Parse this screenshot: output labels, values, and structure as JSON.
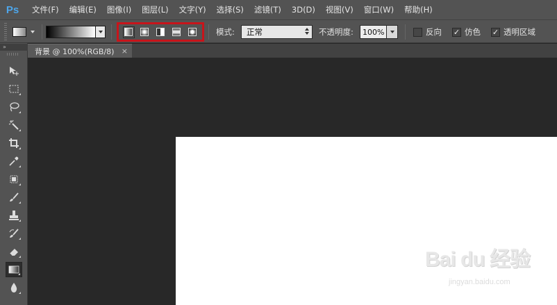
{
  "app": {
    "logo": "Ps"
  },
  "menu": [
    "文件(F)",
    "编辑(E)",
    "图像(I)",
    "图层(L)",
    "文字(Y)",
    "选择(S)",
    "滤镜(T)",
    "3D(D)",
    "视图(V)",
    "窗口(W)",
    "帮助(H)"
  ],
  "options": {
    "gradient_types": [
      {
        "name": "linear",
        "icon": "linear-gradient-icon",
        "active": true
      },
      {
        "name": "radial",
        "icon": "radial-gradient-icon",
        "active": false
      },
      {
        "name": "angle",
        "icon": "angle-gradient-icon",
        "active": false
      },
      {
        "name": "reflected",
        "icon": "reflected-gradient-icon",
        "active": false
      },
      {
        "name": "diamond",
        "icon": "diamond-gradient-icon",
        "active": false
      }
    ],
    "highlight_color": "#c8141a",
    "mode_label": "模式:",
    "mode_value": "正常",
    "opacity_label": "不透明度:",
    "opacity_value": "100%",
    "reverse_label": "反向",
    "reverse_checked": false,
    "dither_label": "仿色",
    "dither_checked": true,
    "transparency_label": "透明区域",
    "transparency_checked": true
  },
  "document_tab": {
    "title": "背景 @ 100%(RGB/8)",
    "close": "×"
  },
  "toolpanel": {
    "collapse": "»",
    "tools": [
      {
        "name": "move-tool",
        "icon": "move-icon",
        "active": false
      },
      {
        "name": "marquee-tool",
        "icon": "rectangular-marquee-icon",
        "active": false
      },
      {
        "name": "lasso-tool",
        "icon": "lasso-icon",
        "active": false
      },
      {
        "name": "magic-wand-tool",
        "icon": "magic-wand-icon",
        "active": false
      },
      {
        "name": "crop-tool",
        "icon": "crop-icon",
        "active": false
      },
      {
        "name": "eyedropper-tool",
        "icon": "eyedropper-icon",
        "active": false
      },
      {
        "name": "healing-brush-tool",
        "icon": "spot-healing-icon",
        "active": false
      },
      {
        "name": "brush-tool",
        "icon": "brush-icon",
        "active": false
      },
      {
        "name": "clone-stamp-tool",
        "icon": "clone-stamp-icon",
        "active": false
      },
      {
        "name": "history-brush-tool",
        "icon": "history-brush-icon",
        "active": false
      },
      {
        "name": "eraser-tool",
        "icon": "eraser-icon",
        "active": false
      },
      {
        "name": "gradient-tool",
        "icon": "gradient-icon",
        "active": true
      },
      {
        "name": "blur-tool",
        "icon": "blur-drop-icon",
        "active": false
      }
    ]
  },
  "watermark": {
    "main": "Bai du 经验",
    "sub": "jingyan.baidu.com"
  }
}
